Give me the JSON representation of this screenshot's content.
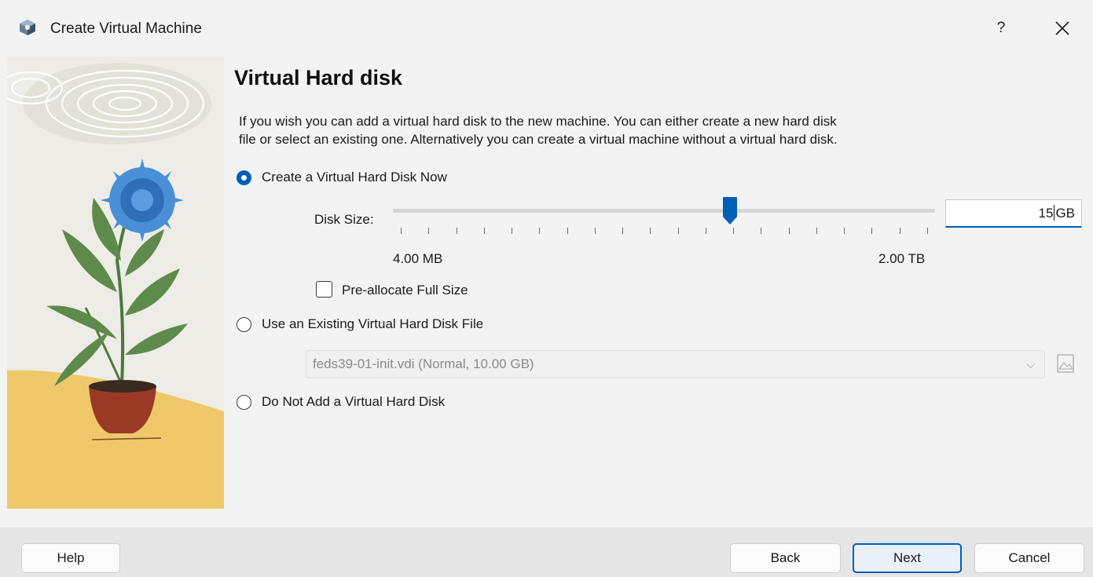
{
  "window": {
    "title": "Create Virtual Machine",
    "help_glyph": "?",
    "close_glyph": "✕"
  },
  "page": {
    "heading": "Virtual Hard disk",
    "description_line1": "If you wish you can add a virtual hard disk to the new machine. You can either create a new hard disk",
    "description_line2": "file or select an existing one. Alternatively you can create a virtual machine without a virtual hard disk."
  },
  "options": {
    "create_now": {
      "label": "Create a Virtual Hard Disk Now",
      "selected": true
    },
    "use_existing": {
      "label": "Use an Existing Virtual Hard Disk File",
      "selected": false
    },
    "do_not_add": {
      "label": "Do Not Add a Virtual Hard Disk",
      "selected": false
    }
  },
  "disk_size": {
    "label": "Disk Size:",
    "min_label": "4.00 MB",
    "max_label": "2.00 TB",
    "value": "15",
    "unit": "GB",
    "slider_fraction": 0.62,
    "tick_count": 20
  },
  "preallocate": {
    "label": "Pre-allocate Full Size",
    "checked": false
  },
  "existing_file": {
    "selected": "feds39-01-init.vdi (Normal, 10.00 GB)",
    "arrow": "⌵"
  },
  "buttons": {
    "help": "Help",
    "back": "Back",
    "next": "Next",
    "cancel": "Cancel"
  },
  "colors": {
    "accent": "#005fb8",
    "background": "#f3f3f3",
    "footer": "#e6e6e6"
  },
  "icons": {
    "app": "virtualbox-cube-icon",
    "close": "close-icon",
    "folder": "folder-browse-icon",
    "dropdown": "chevron-down-icon"
  }
}
